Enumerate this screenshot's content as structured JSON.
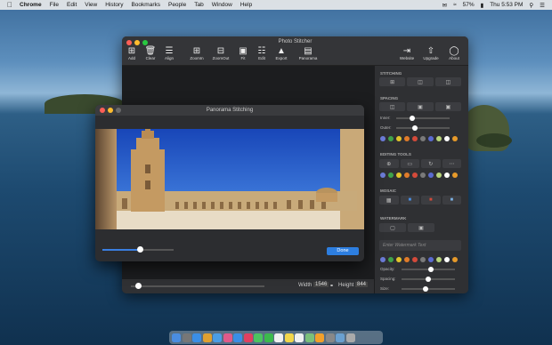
{
  "menubar": {
    "app_name": "Chrome",
    "items": [
      "File",
      "Edit",
      "View",
      "History",
      "Bookmarks",
      "People",
      "Tab",
      "Window",
      "Help"
    ],
    "battery": "57%",
    "clock": "Thu 5:53 PM"
  },
  "main_window": {
    "title": "Photo Stitcher",
    "toolbar": [
      {
        "label": "Add",
        "icon": "plus-square-icon"
      },
      {
        "label": "Clear",
        "icon": "trash-icon"
      },
      {
        "label": "Align",
        "icon": "layers-icon"
      },
      {
        "label": "ZoomIn",
        "icon": "zoom-in-icon"
      },
      {
        "label": "ZoomOut",
        "icon": "zoom-out-icon"
      },
      {
        "label": "Fit",
        "icon": "fit-icon"
      },
      {
        "label": "Edit",
        "icon": "edit-icon"
      },
      {
        "label": "Export",
        "icon": "export-icon"
      },
      {
        "label": "Panorama",
        "icon": "panorama-icon"
      },
      {
        "label": "Website",
        "icon": "website-icon"
      },
      {
        "label": "Upgrade",
        "icon": "upgrade-icon"
      },
      {
        "label": "About",
        "icon": "about-icon"
      }
    ],
    "bottom": {
      "width_label": "Width",
      "width_value": "1546",
      "lock_icon": "lock-icon",
      "height_label": "Height",
      "height_value": "844",
      "zoom_level": 0.05
    }
  },
  "side_panel": {
    "stitching_label": "STITCHING",
    "stitching_buttons": [
      "horizontal-stitch-icon",
      "vertical-stitch-icon",
      "grid-stitch-icon"
    ],
    "spacing_label": "SPACING",
    "spacing_buttons": [
      "spacing-inner-icon",
      "spacing-outer-icon",
      "spacing-all-icon"
    ],
    "inner_label": "Inner:",
    "inner_level": 0.3,
    "outer_label": "Outer:",
    "outer_level": 0.35,
    "border_colors": [
      "#6b7bd6",
      "#3fa24a",
      "#e3c42c",
      "#e07b2a",
      "#d44a3a",
      "#7a7a7a",
      "#5a6bd0",
      "#b8d47a",
      "#ffffff",
      "#e79a2a"
    ],
    "editing_label": "EDITING TOOLS",
    "editing_buttons": [
      "crop-icon",
      "aspect-icon",
      "rotate-icon",
      "more-icon"
    ],
    "editing_colors": [
      "#6b7bd6",
      "#3fa24a",
      "#e3c42c",
      "#e07b2a",
      "#d44a3a",
      "#7a7a7a",
      "#5a6bd0",
      "#b8d47a",
      "#ffffff",
      "#e79a2a"
    ],
    "mosaic_label": "MOSAIC",
    "mosaic_buttons": [
      "mosaic-pixel-icon",
      "mosaic-blue-icon",
      "mosaic-red-icon",
      "mosaic-blur-icon"
    ],
    "watermark_label": "WATERMARK",
    "watermark_buttons": [
      "watermark-image-icon",
      "watermark-text-icon"
    ],
    "watermark_placeholder": "Enter Watermark Text",
    "watermark_colors": [
      "#6b7bd6",
      "#3fa24a",
      "#e3c42c",
      "#e07b2a",
      "#d44a3a",
      "#7a7a7a",
      "#5a6bd0",
      "#b8d47a",
      "#ffffff",
      "#e79a2a"
    ],
    "opacity_label": "Opacity:",
    "opacity_level": 0.55,
    "spacing2_label": "Spacing:",
    "spacing2_level": 0.5,
    "size_label": "Size:",
    "size_level": 0.45
  },
  "dialog": {
    "title": "Panorama Stitching",
    "slider_level": 0.52,
    "done_label": "Done"
  },
  "dock": {
    "apps": [
      "finder-icon",
      "launchpad-icon",
      "safari-icon",
      "chrome-icon",
      "mail-icon",
      "photos-icon",
      "app-store-icon",
      "music-icon",
      "messages-icon",
      "facetime-icon",
      "calendar-icon",
      "notes-icon",
      "reminders-icon",
      "maps-icon",
      "sketch-icon",
      "system-preferences-icon",
      "preview-icon",
      "trash-icon"
    ],
    "app_colors": [
      "#4a8de0",
      "#777",
      "#3a8ee6",
      "#e0a030",
      "#4a9de6",
      "#e05a8a",
      "#3a8ee6",
      "#e04060",
      "#4cc460",
      "#3cba4c",
      "#f0f0f0",
      "#f2d64a",
      "#f0f0f0",
      "#7ac07a",
      "#f2a02a",
      "#888",
      "#6aa0d0",
      "#aaa"
    ]
  }
}
